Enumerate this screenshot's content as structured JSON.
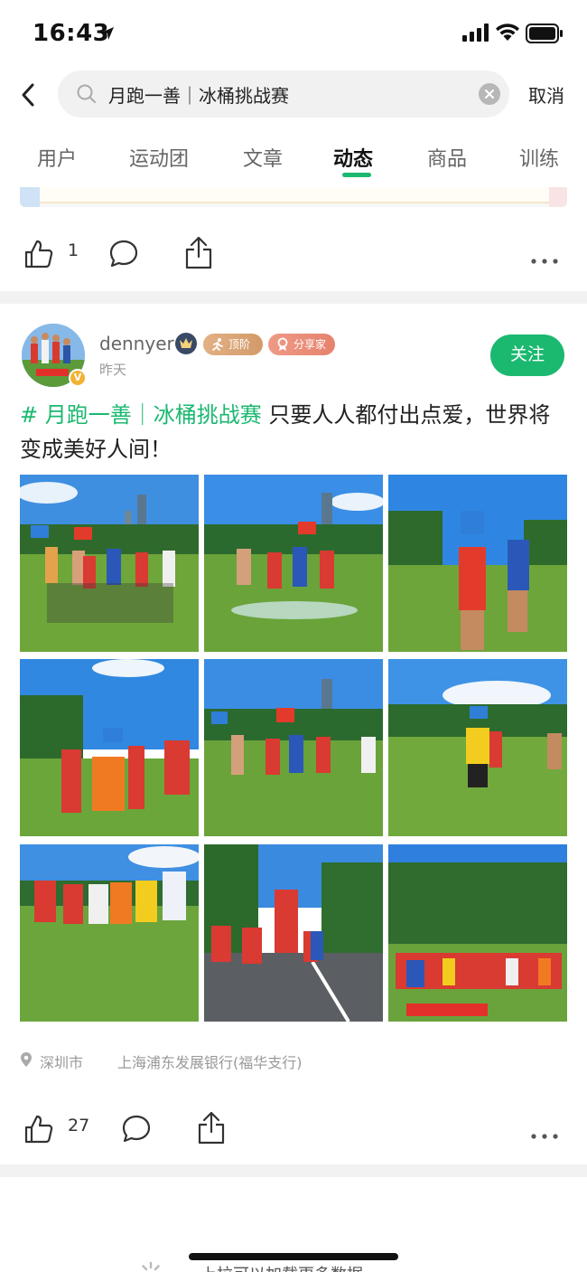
{
  "status_bar": {
    "time": "16:43"
  },
  "search": {
    "query": "月跑一善｜冰桶挑战赛",
    "cancel_label": "取消"
  },
  "tabs": [
    {
      "label": "用户"
    },
    {
      "label": "运动团"
    },
    {
      "label": "文章"
    },
    {
      "label": "动态",
      "active": true
    },
    {
      "label": "商品"
    },
    {
      "label": "训练"
    }
  ],
  "prev_post": {
    "like_count": "1"
  },
  "post": {
    "username": "dennyer",
    "badges": {
      "level": "顶阶",
      "sharer": "分享家"
    },
    "time_ago": "昨天",
    "follow_label": "关注",
    "hashtag": "# 月跑一善｜冰桶挑战赛",
    "text": " 只要人人都付出点爱，世界将变成美好人间！",
    "photo_count": 9,
    "location": {
      "city": "深圳市",
      "place": "上海浦东发展银行(福华支行)"
    },
    "like_count": "27"
  },
  "footer": {
    "loading_text": "上拉可以加载更多数据"
  },
  "colors": {
    "accent": "#1bb870",
    "divider": "#f2f2f2"
  }
}
